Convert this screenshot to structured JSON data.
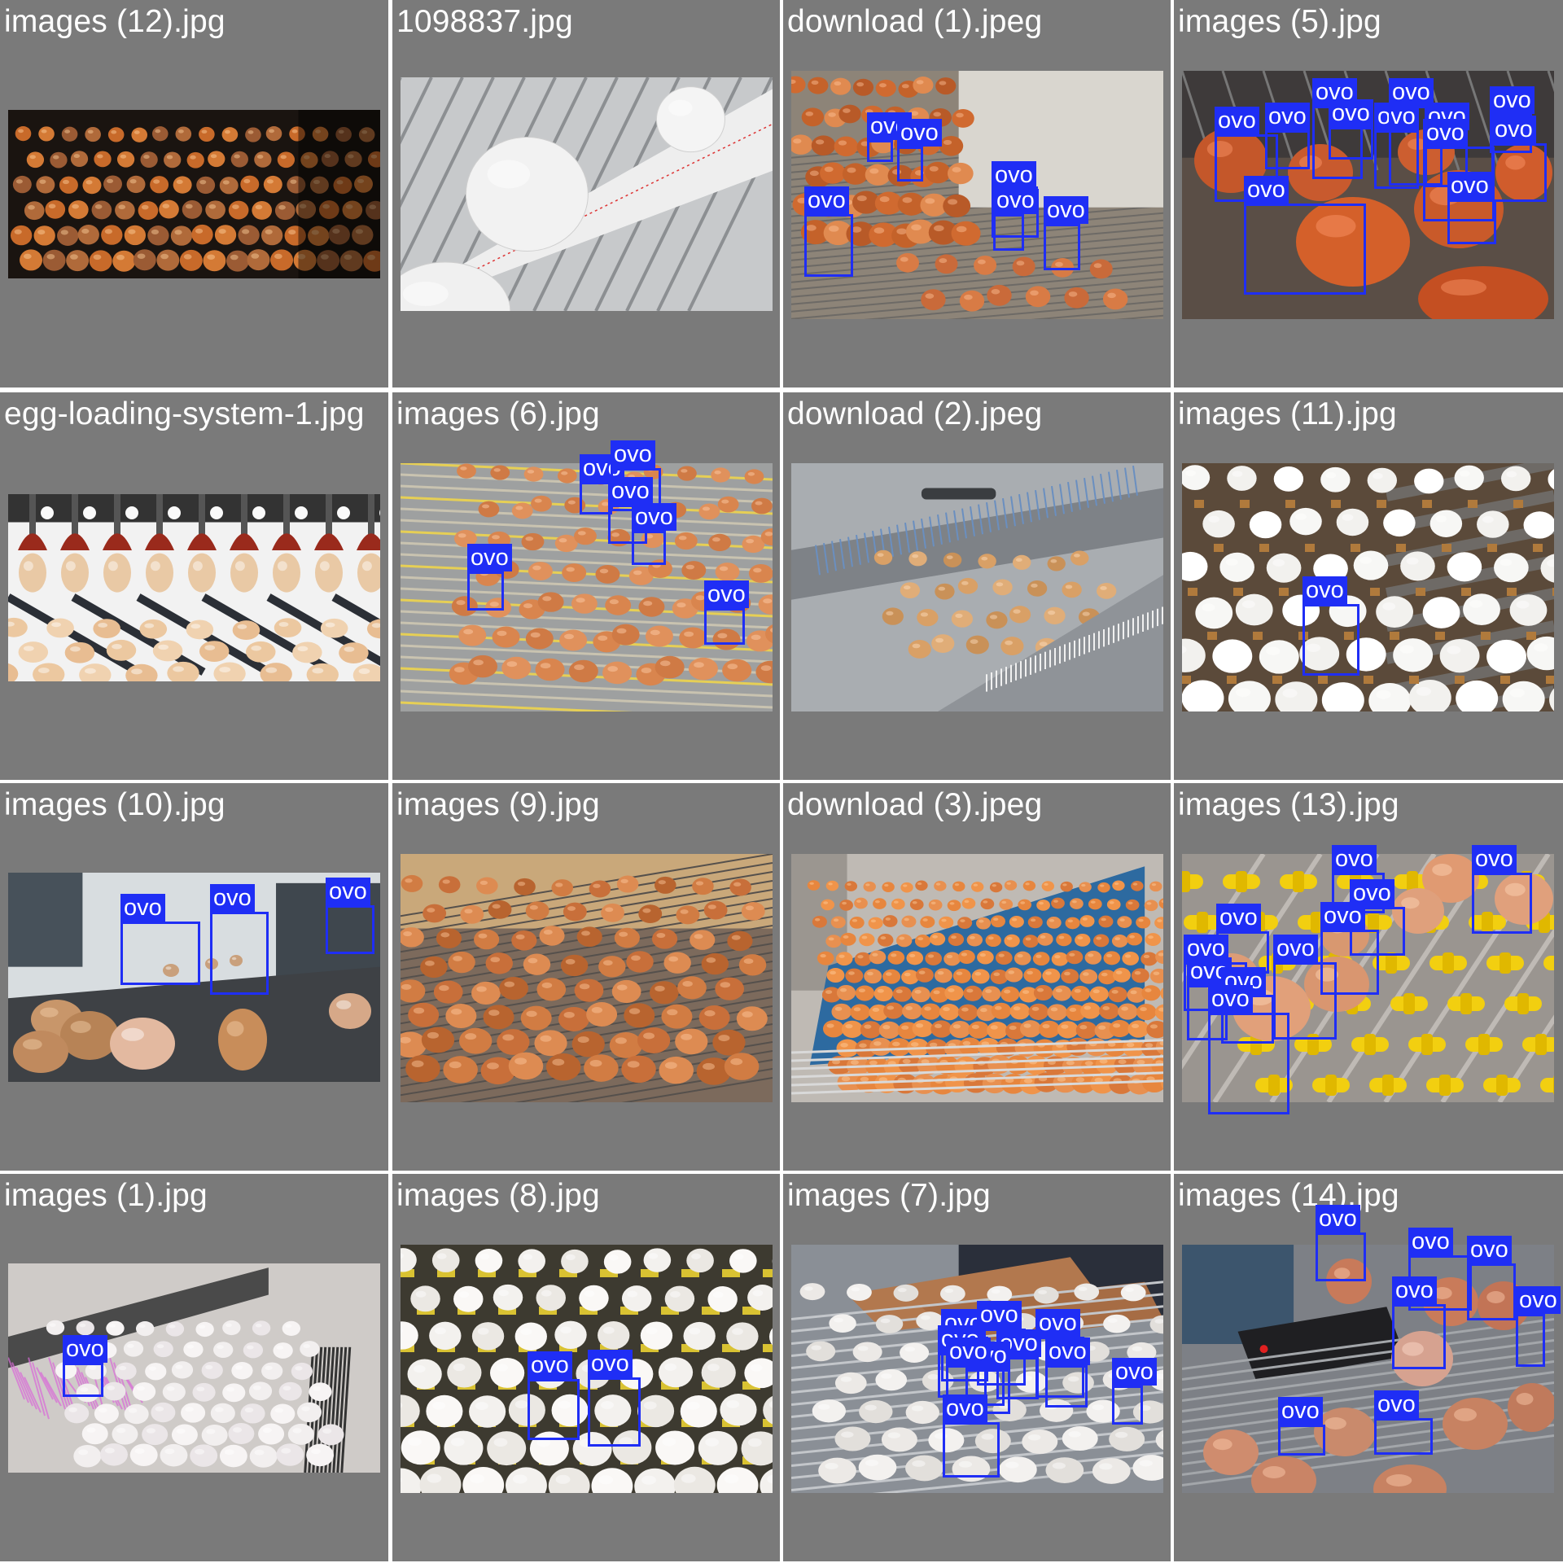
{
  "detection_label": "ovo",
  "colors": {
    "panel_bg": "#7a7a7a",
    "label_text": "#ffffff",
    "box": "#1f2ef5",
    "grid_line": "#ffffff"
  },
  "cells": [
    {
      "filename": "images (12).jpg",
      "scene": "night",
      "detections": []
    },
    {
      "filename": "1098837.jpg",
      "scene": "white",
      "detections": []
    },
    {
      "filename": "download (1).jpeg",
      "scene": "brown",
      "detections": [
        {
          "label": "ovo"
        },
        {
          "label": "ovo"
        },
        {
          "label": "ovo"
        },
        {
          "label": "ovo"
        },
        {
          "label": "ovo"
        },
        {
          "label": "ovo"
        }
      ]
    },
    {
      "filename": "images (5).jpg",
      "scene": "brownclose",
      "detections": [
        {
          "label": "ovo"
        },
        {
          "label": "ovo"
        },
        {
          "label": "ovo"
        },
        {
          "label": "ovo"
        },
        {
          "label": "ovo"
        },
        {
          "label": "ovo"
        },
        {
          "label": "ovo"
        },
        {
          "label": "ovo"
        },
        {
          "label": "ovo"
        },
        {
          "label": "ovo"
        },
        {
          "label": "ovo"
        },
        {
          "label": "ovo"
        }
      ]
    },
    {
      "filename": "egg-loading-system-1.jpg",
      "scene": "loader",
      "detections": []
    },
    {
      "filename": "images (6).jpg",
      "scene": "yellowlines",
      "detections": [
        {
          "label": "ovo"
        },
        {
          "label": "ovo"
        },
        {
          "label": "ovo"
        },
        {
          "label": "ovo"
        },
        {
          "label": "ovo"
        },
        {
          "label": "ovo"
        }
      ]
    },
    {
      "filename": "download (2).jpeg",
      "scene": "metal",
      "detections": []
    },
    {
      "filename": "images (11).jpg",
      "scene": "whiteeggs",
      "detections": [
        {
          "label": "ovo"
        }
      ]
    },
    {
      "filename": "images (10).jpg",
      "scene": "belt",
      "detections": [
        {
          "label": "ovo"
        },
        {
          "label": "ovo"
        },
        {
          "label": "ovo"
        }
      ]
    },
    {
      "filename": "images (9).jpg",
      "scene": "brownrows",
      "detections": []
    },
    {
      "filename": "download (3).jpeg",
      "scene": "factory",
      "detections": []
    },
    {
      "filename": "images (13).jpg",
      "scene": "yellowrollers",
      "detections": [
        {
          "label": "ovo"
        },
        {
          "label": "ovo"
        },
        {
          "label": "ovo"
        },
        {
          "label": "ovo"
        },
        {
          "label": "ovo"
        },
        {
          "label": "ovo"
        },
        {
          "label": "ovo"
        },
        {
          "label": "ovo"
        },
        {
          "label": "ovo"
        },
        {
          "label": "ovo"
        }
      ]
    },
    {
      "filename": "images (1).jpg",
      "scene": "pinklight",
      "detections": [
        {
          "label": "ovo"
        }
      ]
    },
    {
      "filename": "images (8).jpg",
      "scene": "whitegrid",
      "detections": [
        {
          "label": "ovo"
        },
        {
          "label": "ovo"
        }
      ]
    },
    {
      "filename": "images (7).jpg",
      "scene": "hands",
      "detections": [
        {
          "label": "ovo"
        },
        {
          "label": "ovo"
        },
        {
          "label": "ovo"
        },
        {
          "label": "ovo"
        },
        {
          "label": "ovo"
        },
        {
          "label": "ovo"
        },
        {
          "label": "ovo"
        },
        {
          "label": "ovo"
        },
        {
          "label": "ovo"
        },
        {
          "label": "ovo"
        }
      ]
    },
    {
      "filename": "images (14).jpg",
      "scene": "browndevice",
      "detections": [
        {
          "label": "ovo"
        },
        {
          "label": "ovo"
        },
        {
          "label": "ovo"
        },
        {
          "label": "ovo"
        },
        {
          "label": "ovo"
        },
        {
          "label": "ovo"
        },
        {
          "label": "ovo"
        }
      ]
    }
  ]
}
